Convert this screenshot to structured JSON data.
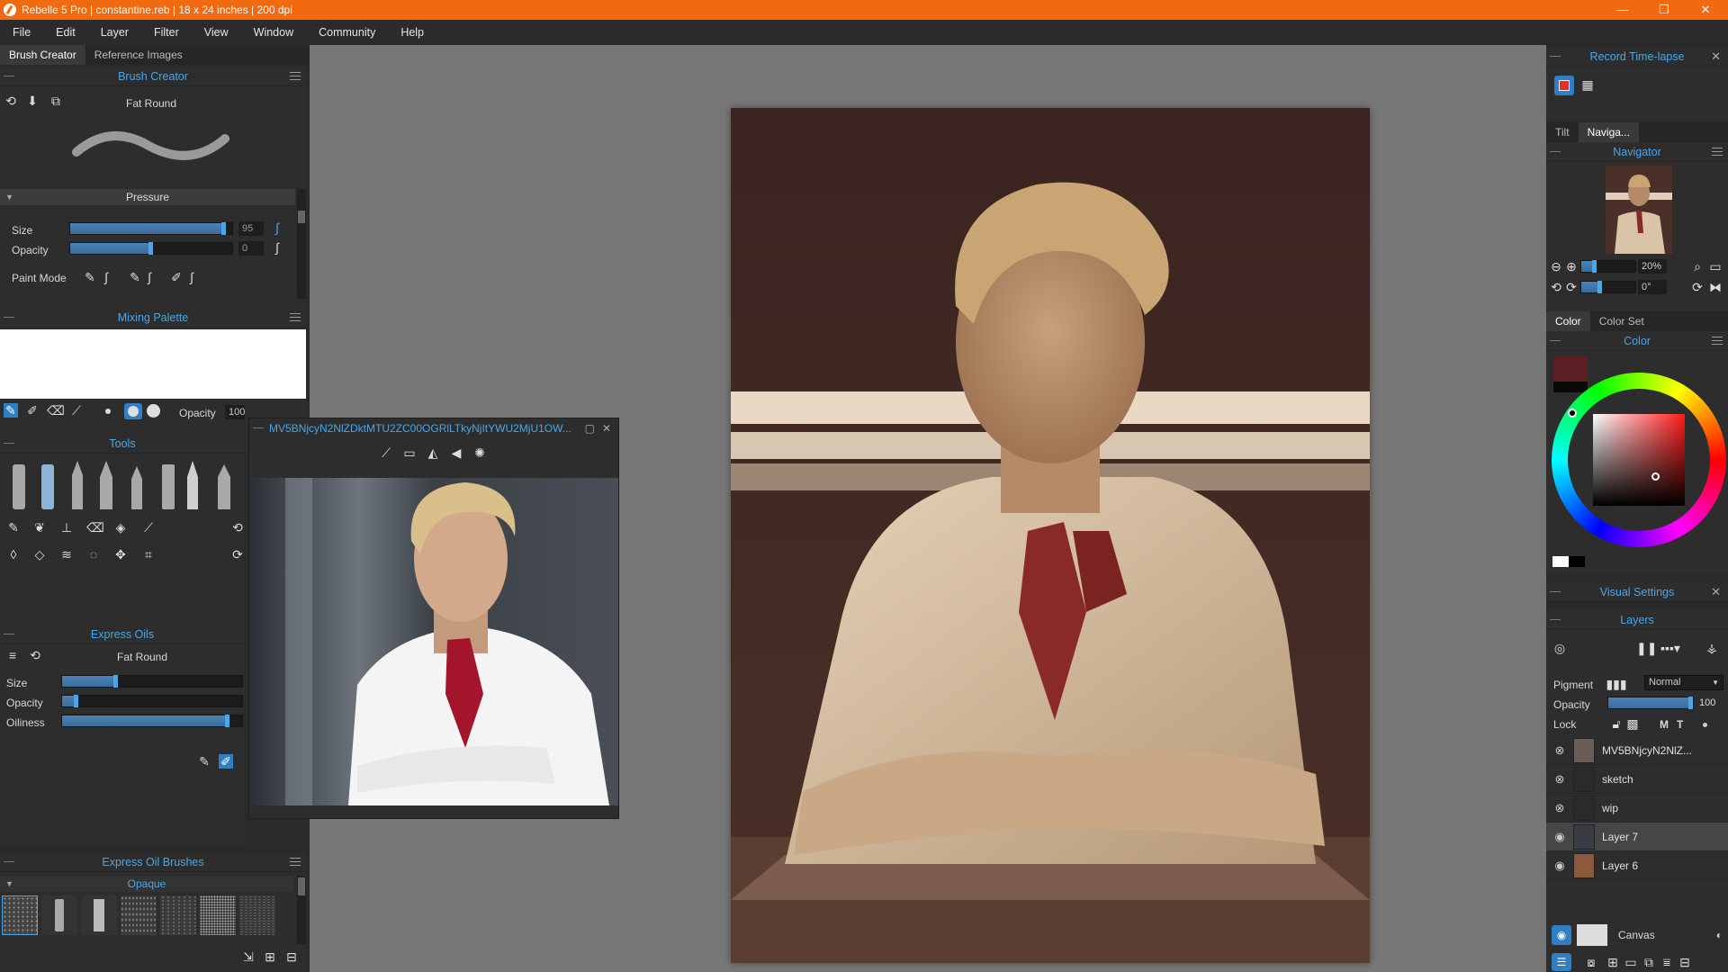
{
  "window": {
    "title": "Rebelle 5 Pro | constantine.reb | 18 x 24 inches | 200 dpi"
  },
  "menu": [
    "File",
    "Edit",
    "Layer",
    "Filter",
    "View",
    "Window",
    "Community",
    "Help"
  ],
  "left_tabs": [
    "Brush Creator",
    "Reference Images"
  ],
  "brush_creator": {
    "title": "Brush Creator",
    "brush_name": "Fat Round",
    "pressure_label": "Pressure",
    "size_label": "Size",
    "size_value": "95",
    "size_level": 0.95,
    "opacity_label": "Opacity",
    "opacity_value": "0",
    "opacity_level": 0.5,
    "paint_mode_label": "Paint Mode"
  },
  "mixing_palette": {
    "title": "Mixing Palette",
    "opacity_label": "Opacity",
    "opacity_value": "100"
  },
  "tools": {
    "title": "Tools"
  },
  "express_oils": {
    "title": "Express Oils",
    "brush_name": "Fat Round",
    "size_label": "Size",
    "size_level": 0.3,
    "opacity_label": "Opacity",
    "opacity_level": 0.08,
    "oiliness_label": "Oiliness",
    "oiliness_level": 0.92
  },
  "express_oil_brushes": {
    "title": "Express Oil Brushes",
    "category": "Opaque"
  },
  "reference_window": {
    "title": "MV5BNjcyN2NlZDktMTU2ZC00OGRlLTkyNjItYWU2MjU1OW..."
  },
  "record": {
    "title": "Record Time-lapse"
  },
  "nav_tabs": [
    "Tilt",
    "Naviga..."
  ],
  "navigator": {
    "title": "Navigator",
    "zoom": "20%",
    "rotation": "0°",
    "zoom_level": 0.25,
    "rotation_level": 0.35
  },
  "color_tabs": [
    "Color",
    "Color Set"
  ],
  "color": {
    "title": "Color",
    "current": "#5c1e22",
    "previous": "#0a0a0a"
  },
  "visual_settings": {
    "title": "Visual Settings"
  },
  "layers": {
    "title": "Layers",
    "pigment_label": "Pigment",
    "blend_mode": "Normal",
    "opacity_label": "Opacity",
    "opacity_value": "100",
    "opacity_level": 1.0,
    "lock_label": "Lock",
    "lock_m": "M",
    "lock_t": "T",
    "items": [
      {
        "name": "MV5BNjcyN2NlZ..."
      },
      {
        "name": "sketch"
      },
      {
        "name": "wip"
      },
      {
        "name": "Layer 7"
      },
      {
        "name": "Layer 6"
      }
    ],
    "canvas_label": "Canvas"
  },
  "colors": {
    "accent": "#4aa6e8",
    "titlebar": "#f26a10",
    "panel": "#2d2d2d"
  }
}
